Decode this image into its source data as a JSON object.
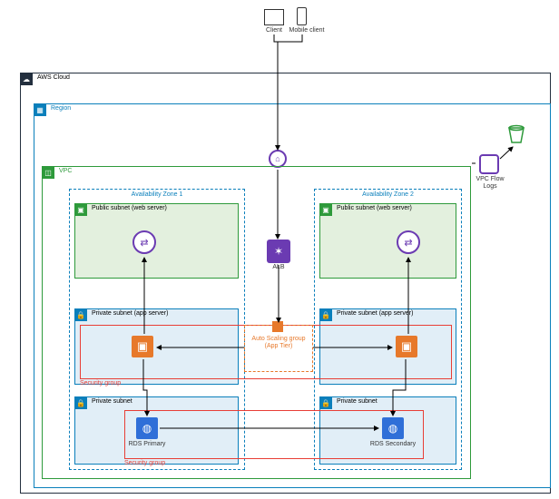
{
  "clients": {
    "pc": "Client",
    "mobile": "Mobile client"
  },
  "aws_cloud": "AWS Cloud",
  "region": "Region",
  "vpc": "VPC",
  "vpc_flow_logs": "VPC Flow\nLogs",
  "alb": "ALB",
  "asg": "Auto Scaling group\n(App Tier)",
  "az1": {
    "title": "Availability Zone 1",
    "public": "Public subnet (web server)",
    "priv_app": "Private subnet (app server)",
    "priv_db": "Private subnet",
    "sec1": "Security group",
    "sec2": "Security group",
    "rds": "RDS Primary"
  },
  "az2": {
    "title": "Availability Zone 2",
    "public": "Public subnet (web server)",
    "priv_app": "Private subnet (app server)",
    "priv_db": "Private subnet",
    "rds": "RDS Secondary"
  },
  "colors": {
    "cloud": "#232F3E",
    "region": "#0A7FBB",
    "vpc": "#2E9A3B",
    "az": "#0A7FBB",
    "public": "#2E9A3B",
    "public_bg": "#E3F0DE",
    "private": "#0A7FBB",
    "private_bg": "#E1EEF7",
    "sec": "#E83E36",
    "asg": "#E7792B",
    "alb": "#6B3BB2",
    "flow": "#6B3BB2",
    "ec2": "#E7792B",
    "rds": "#2F6FD8",
    "elb": "#6B3BB2",
    "igw": "#6B3BB2"
  }
}
